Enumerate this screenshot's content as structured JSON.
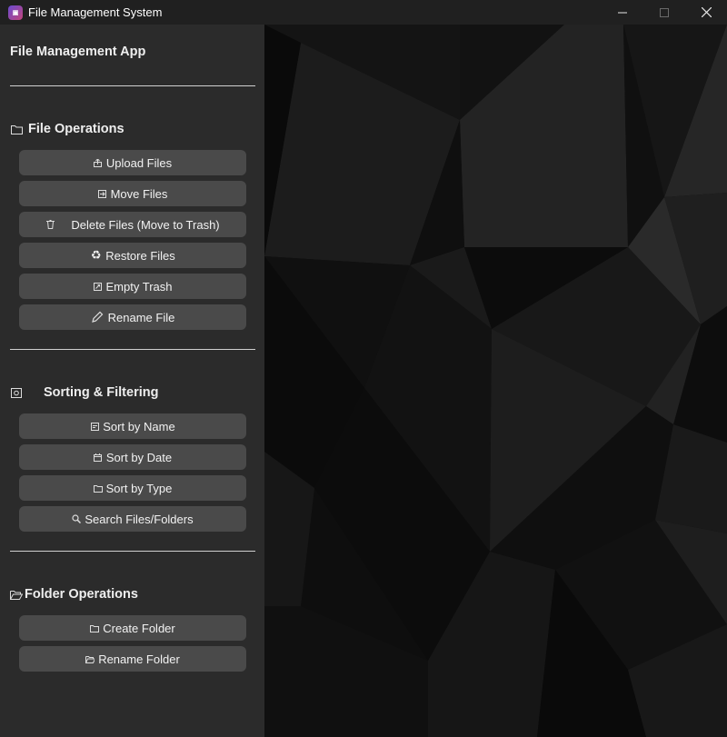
{
  "window": {
    "title": "File Management System",
    "icon": "app-logo-icon",
    "controls": [
      "minimize-icon",
      "maximize-icon",
      "close-icon"
    ]
  },
  "sidebar": {
    "app_title": "File Management App",
    "sections": [
      {
        "title": "File Operations",
        "icon": "folder-icon",
        "buttons": [
          {
            "label": "Upload Files",
            "icon": "upload-icon"
          },
          {
            "label": "Move Files",
            "icon": "move-icon"
          },
          {
            "label": "Delete Files (Move to Trash)",
            "icon": "trash-icon"
          },
          {
            "label": "Restore Files",
            "icon": "recycle-icon"
          },
          {
            "label": "Empty Trash",
            "icon": "empty-trash-icon"
          },
          {
            "label": "Rename File",
            "icon": "pencil-icon"
          }
        ]
      },
      {
        "title": "Sorting & Filtering",
        "icon": "sort-filter-icon",
        "buttons": [
          {
            "label": "Sort by Name",
            "icon": "sort-name-icon"
          },
          {
            "label": "Sort by Date",
            "icon": "calendar-icon"
          },
          {
            "label": "Sort by Type",
            "icon": "folder-type-icon"
          },
          {
            "label": "Search Files/Folders",
            "icon": "search-icon"
          }
        ]
      },
      {
        "title": "Folder Operations",
        "icon": "open-folder-icon",
        "buttons": [
          {
            "label": "Create Folder",
            "icon": "create-folder-icon"
          },
          {
            "label": "Rename Folder",
            "icon": "rename-folder-icon"
          }
        ]
      }
    ]
  },
  "colors": {
    "titlebar": "#202020",
    "sidebar": "#2b2b2b",
    "button": "#4a4a4a",
    "text": "#f0f0f0"
  }
}
